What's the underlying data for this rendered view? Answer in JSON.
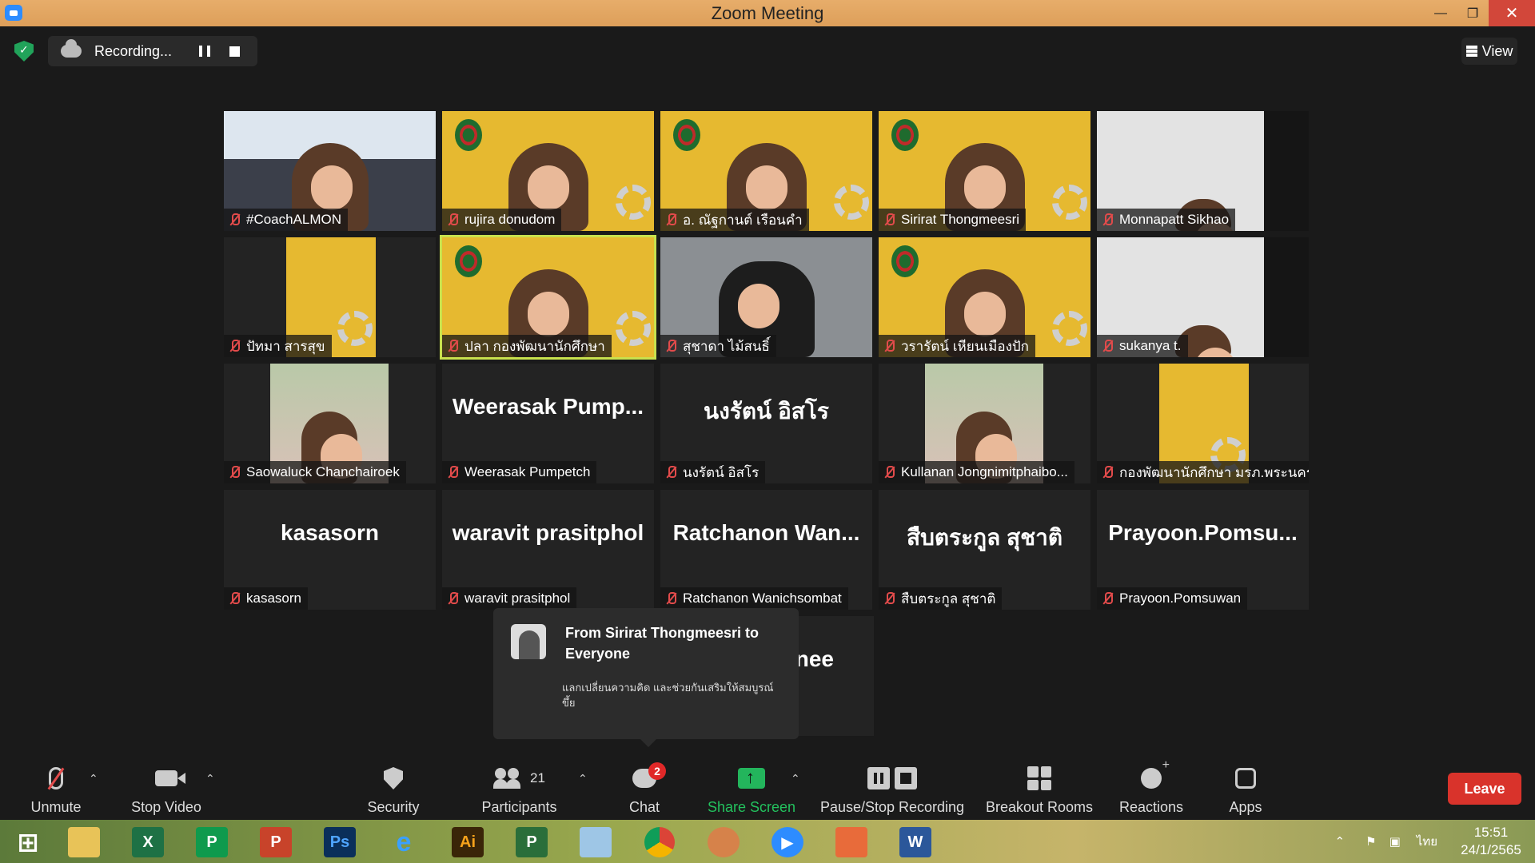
{
  "window": {
    "title": "Zoom Meeting",
    "controls": [
      "—",
      "❐",
      "✕"
    ]
  },
  "topbar": {
    "recording_label": "Recording...",
    "view_label": "View"
  },
  "participants": [
    {
      "name": "#CoachALMON",
      "video": "coach"
    },
    {
      "name": "rujira donudom",
      "video": "poster"
    },
    {
      "name": "อ. ณัฐกานต์  เรือนคำ",
      "video": "poster"
    },
    {
      "name": "Sirirat Thongmeesri",
      "video": "poster"
    },
    {
      "name": "Monnapatt Sikhao",
      "video": "room"
    },
    {
      "name": "ปัทมา สารสุข",
      "video": "poster-small"
    },
    {
      "name": "ปลา กองพัฒนานักศึกษา",
      "video": "poster",
      "active": true
    },
    {
      "name": "สุชาดา ไม้สนธิ์",
      "video": "dark"
    },
    {
      "name": "วรารัตน์ เหียนเมืองปัก",
      "video": "poster"
    },
    {
      "name": "sukanya t.",
      "video": "room"
    },
    {
      "name": "Saowaluck Chanchairoek",
      "video": "photo"
    },
    {
      "name": "Weerasak Pumpetch",
      "big": "Weerasak  Pump..."
    },
    {
      "name": "นงรัตน์ อิสโร",
      "big": "นงรัตน์ อิสโร"
    },
    {
      "name": "Kullanan Jongnimitphaibo...",
      "video": "photo"
    },
    {
      "name": "กองพัฒนานักศึกษา มรภ.พระนคร",
      "video": "poster-small"
    },
    {
      "name": "kasasorn",
      "big": "kasasorn"
    },
    {
      "name": "waravit prasitphol",
      "big": "waravit prasitphol"
    },
    {
      "name": "Ratchanon Wanichsombat",
      "big": "Ratchanon  Wan..."
    },
    {
      "name": "สืบตระกูล สุชาติ",
      "big": "สืบตระกูล สุชาติ"
    },
    {
      "name": "Prayoon.Pomsuwan",
      "big": "Prayoon.Pomsu..."
    }
  ],
  "partial_tile": {
    "big": "nee"
  },
  "chat_popup": {
    "from": "From Sirirat Thongmeesri to Everyone",
    "message": "แลกเปลี่ยนความคิด และช่วยกันเสริมให้สมบูรณ์ขึ้ย"
  },
  "toolbar": {
    "unmute": "Unmute",
    "stop_video": "Stop Video",
    "security": "Security",
    "participants": "Participants",
    "participants_count": "21",
    "chat": "Chat",
    "chat_badge": "2",
    "share_screen": "Share Screen",
    "pause_stop_recording": "Pause/Stop Recording",
    "breakout_rooms": "Breakout Rooms",
    "reactions": "Reactions",
    "apps": "Apps",
    "leave": "Leave"
  },
  "taskbar": {
    "apps": [
      "start",
      "file-explorer",
      "excel",
      "publisher",
      "powerpoint",
      "photoshop",
      "internet-explorer",
      "illustrator",
      "project",
      "notes",
      "chrome",
      "paint",
      "zoom",
      "office",
      "word"
    ],
    "language": "ไทย",
    "time": "15:51",
    "date": "24/1/2565"
  }
}
